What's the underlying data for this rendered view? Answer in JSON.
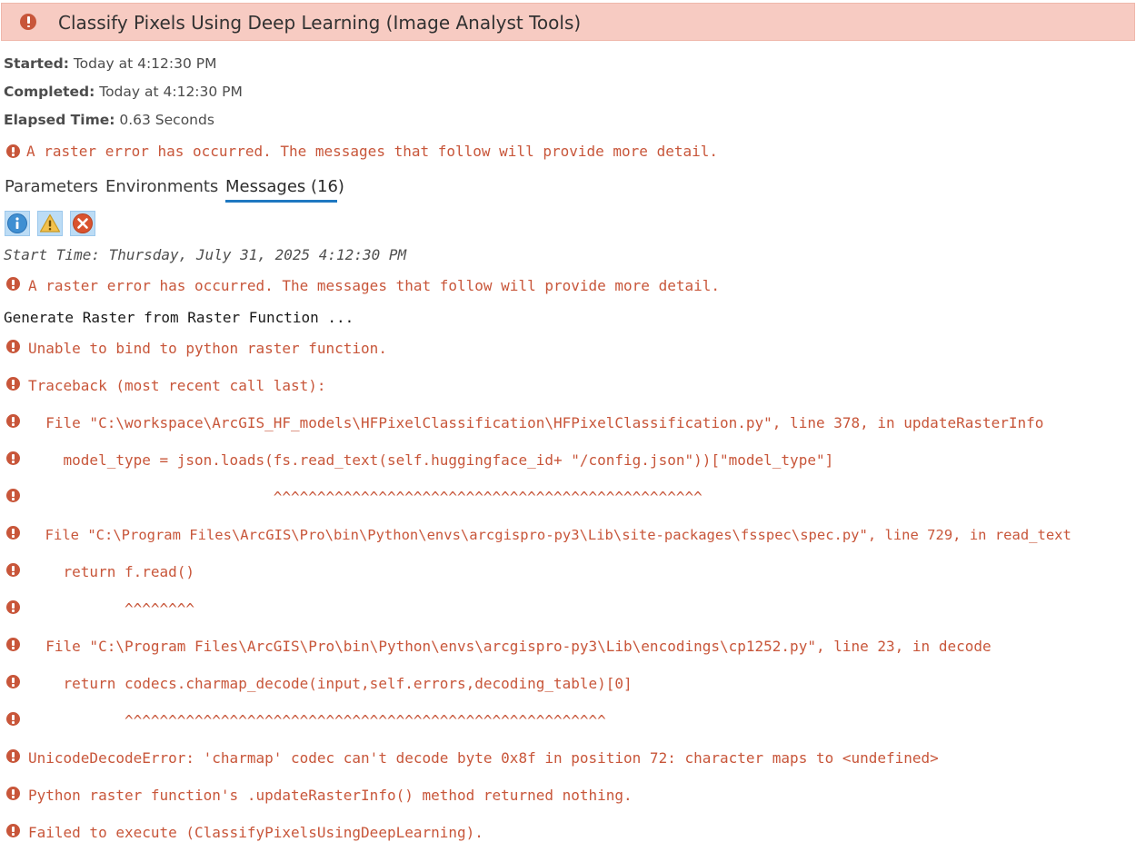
{
  "header": {
    "title": "Classify Pixels Using Deep Learning (Image Analyst Tools)",
    "icon": "error-icon",
    "background": "#f7cbc2"
  },
  "info": {
    "started_label": "Started:",
    "started_value": " Today at 4:12:30 PM",
    "completed_label": "Completed:",
    "completed_value": " Today at 4:12:30 PM",
    "elapsed_label": "Elapsed Time:",
    "elapsed_value": " 0.63 Seconds"
  },
  "summary_error": "A raster error has occurred. The messages that follow will provide more detail.",
  "tabs": [
    {
      "label": "Parameters",
      "active": false
    },
    {
      "label": "Environments",
      "active": false
    },
    {
      "label": "Messages (16)",
      "active": true
    }
  ],
  "filters": [
    {
      "name": "info-filter",
      "icon": "info-icon"
    },
    {
      "name": "warning-filter",
      "icon": "warning-icon"
    },
    {
      "name": "error-filter",
      "icon": "error-icon"
    }
  ],
  "messages": [
    {
      "type": "info",
      "text": "Start Time: Thursday, July 31, 2025 4:12:30 PM"
    },
    {
      "type": "error",
      "text": "A raster error has occurred. The messages that follow will provide more detail."
    },
    {
      "type": "plain",
      "text": "Generate Raster from Raster Function ..."
    },
    {
      "type": "error",
      "text": "Unable to bind to python raster function."
    },
    {
      "type": "error",
      "text": "Traceback (most recent call last):"
    },
    {
      "type": "error",
      "text": "  File \"C:\\workspace\\ArcGIS_HF_models\\HFPixelClassification\\HFPixelClassification.py\", line 378, in updateRasterInfo"
    },
    {
      "type": "error",
      "text": "    model_type = json.loads(fs.read_text(self.huggingface_id+ \"/config.json\"))[\"model_type\"]"
    },
    {
      "type": "error",
      "text": "                            ^^^^^^^^^^^^^^^^^^^^^^^^^^^^^^^^^^^^^^^^^^^^^^^^^"
    },
    {
      "type": "error",
      "text": "  File \"C:\\Program Files\\ArcGIS\\Pro\\bin\\Python\\envs\\arcgispro-py3\\Lib\\site-packages\\fsspec\\spec.py\", line 729, in read_text"
    },
    {
      "type": "error",
      "text": "    return f.read()"
    },
    {
      "type": "error",
      "text": "           ^^^^^^^^"
    },
    {
      "type": "error",
      "text": "  File \"C:\\Program Files\\ArcGIS\\Pro\\bin\\Python\\envs\\arcgispro-py3\\Lib\\encodings\\cp1252.py\", line 23, in decode"
    },
    {
      "type": "error",
      "text": "    return codecs.charmap_decode(input,self.errors,decoding_table)[0]"
    },
    {
      "type": "error",
      "text": "           ^^^^^^^^^^^^^^^^^^^^^^^^^^^^^^^^^^^^^^^^^^^^^^^^^^^^^^^"
    },
    {
      "type": "error",
      "text": "UnicodeDecodeError: 'charmap' codec can't decode byte 0x8f in position 72: character maps to <undefined>"
    },
    {
      "type": "error",
      "text": "Python raster function's .updateRasterInfo() method returned nothing."
    },
    {
      "type": "error",
      "text": "Failed to execute (ClassifyPixelsUsingDeepLearning)."
    }
  ],
  "colors": {
    "error": "#c8563a",
    "tab_underline": "#1f78c1",
    "filter_bg": "#bcdcf5"
  }
}
